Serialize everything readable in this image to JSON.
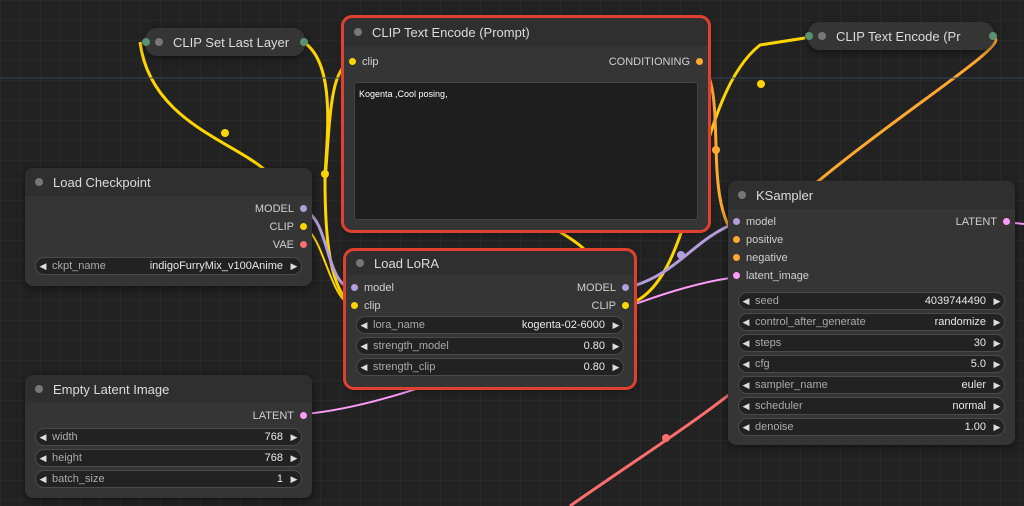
{
  "colors": {
    "model": "#b39ddb",
    "clip": "#ffd500",
    "vae": "#ff6e6e",
    "conditioning": "#ffa931",
    "latent": "#ff9cf9",
    "selected": "#e0402e",
    "background": "#222222"
  },
  "nodes": {
    "clip_set_last_layer": {
      "title": "CLIP Set Last Layer"
    },
    "clip_text_encode_1": {
      "title": "CLIP Text Encode (Prompt)",
      "input_clip": "clip",
      "output": "CONDITIONING",
      "text": "Kogenta ,Cool posing,"
    },
    "clip_text_encode_2": {
      "title": "CLIP Text Encode (Pr"
    },
    "load_checkpoint": {
      "title": "Load Checkpoint",
      "out_model": "MODEL",
      "out_clip": "CLIP",
      "out_vae": "VAE",
      "ckpt_name_label": "ckpt_name",
      "ckpt_name_value": "indigoFurryMix_v100Anime"
    },
    "load_lora": {
      "title": "Load LoRA",
      "in_model": "model",
      "in_clip": "clip",
      "out_model": "MODEL",
      "out_clip": "CLIP",
      "widgets": [
        {
          "label": "lora_name",
          "value": "kogenta-02-6000"
        },
        {
          "label": "strength_model",
          "value": "0.80"
        },
        {
          "label": "strength_clip",
          "value": "0.80"
        }
      ]
    },
    "empty_latent": {
      "title": "Empty Latent Image",
      "out_latent": "LATENT",
      "widgets": [
        {
          "label": "width",
          "value": "768"
        },
        {
          "label": "height",
          "value": "768"
        },
        {
          "label": "batch_size",
          "value": "1"
        }
      ]
    },
    "ksampler": {
      "title": "KSampler",
      "in_model": "model",
      "in_positive": "positive",
      "in_negative": "negative",
      "in_latent": "latent_image",
      "out_latent": "LATENT",
      "widgets": [
        {
          "label": "seed",
          "value": "4039744490"
        },
        {
          "label": "control_after_generate",
          "value": "randomize"
        },
        {
          "label": "steps",
          "value": "30"
        },
        {
          "label": "cfg",
          "value": "5.0"
        },
        {
          "label": "sampler_name",
          "value": "euler"
        },
        {
          "label": "scheduler",
          "value": "normal"
        },
        {
          "label": "denoise",
          "value": "1.00"
        }
      ]
    }
  }
}
